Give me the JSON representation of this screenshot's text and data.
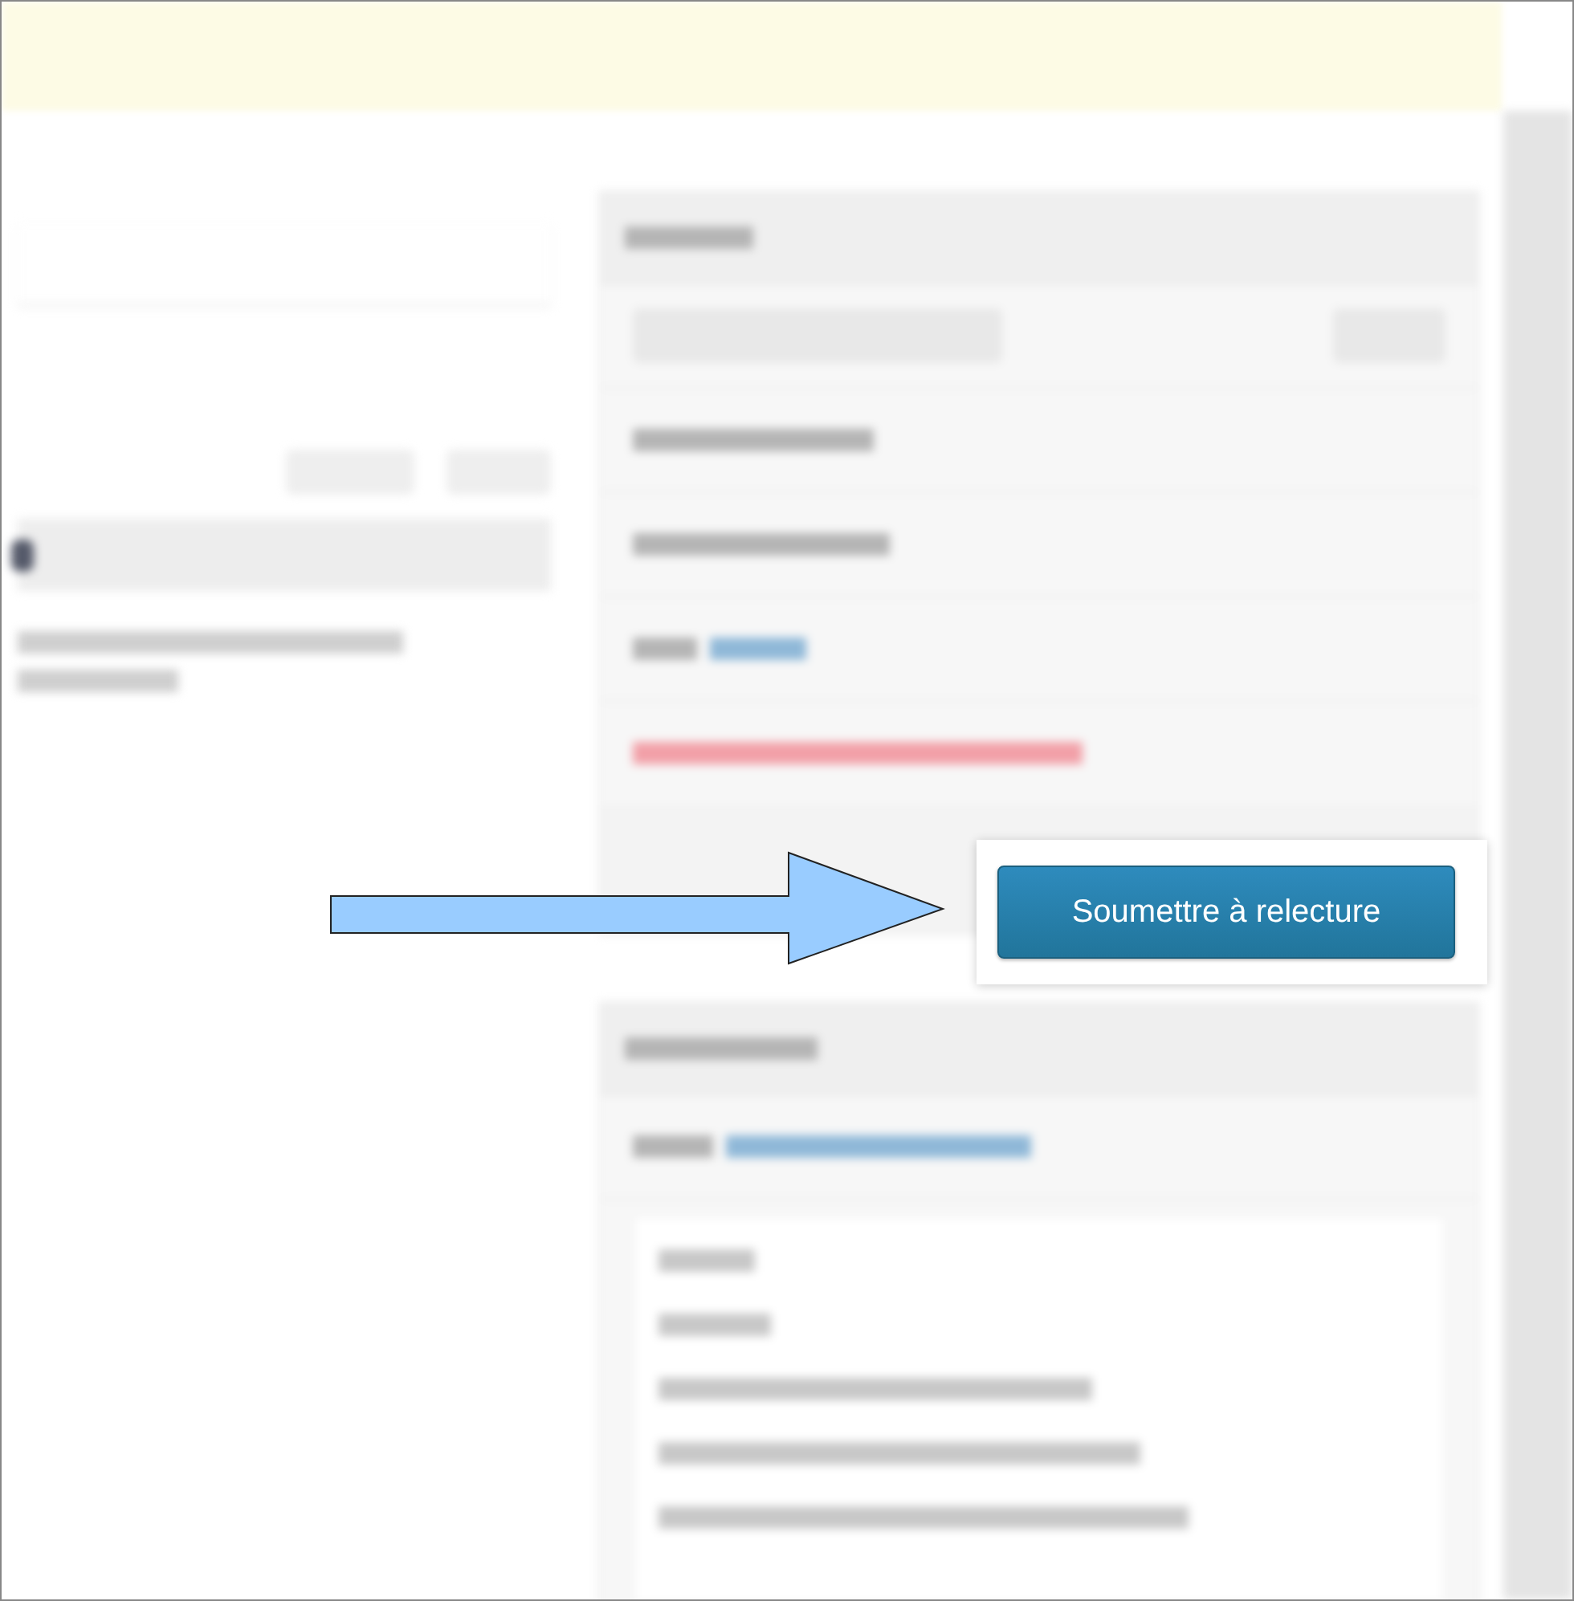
{
  "submit_popup": {
    "button": {
      "label": "Soumettre à relecture"
    }
  }
}
